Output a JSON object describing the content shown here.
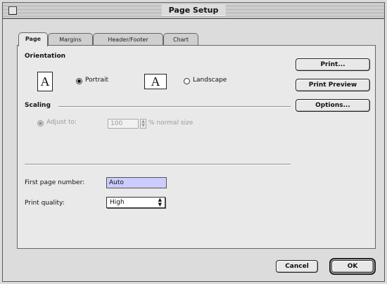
{
  "window": {
    "title": "Page Setup"
  },
  "tabs": [
    {
      "label": "Page",
      "active": true
    },
    {
      "label": "Margins",
      "active": false
    },
    {
      "label": "Header/Footer",
      "active": false
    },
    {
      "label": "Chart",
      "active": false
    }
  ],
  "orientation": {
    "label": "Orientation",
    "portrait_label": "Portrait",
    "landscape_label": "Landscape",
    "selected": "portrait",
    "icon_glyph": "A"
  },
  "scaling": {
    "label": "Scaling",
    "adjust_label": "Adjust to:",
    "value": "100",
    "suffix": "% normal size",
    "enabled": false
  },
  "first_page_number": {
    "label": "First page number:",
    "value": "Auto"
  },
  "print_quality": {
    "label": "Print quality:",
    "value": "High"
  },
  "side_buttons": {
    "print": "Print...",
    "print_preview": "Print Preview",
    "options": "Options..."
  },
  "footer_buttons": {
    "cancel": "Cancel",
    "ok": "OK"
  }
}
